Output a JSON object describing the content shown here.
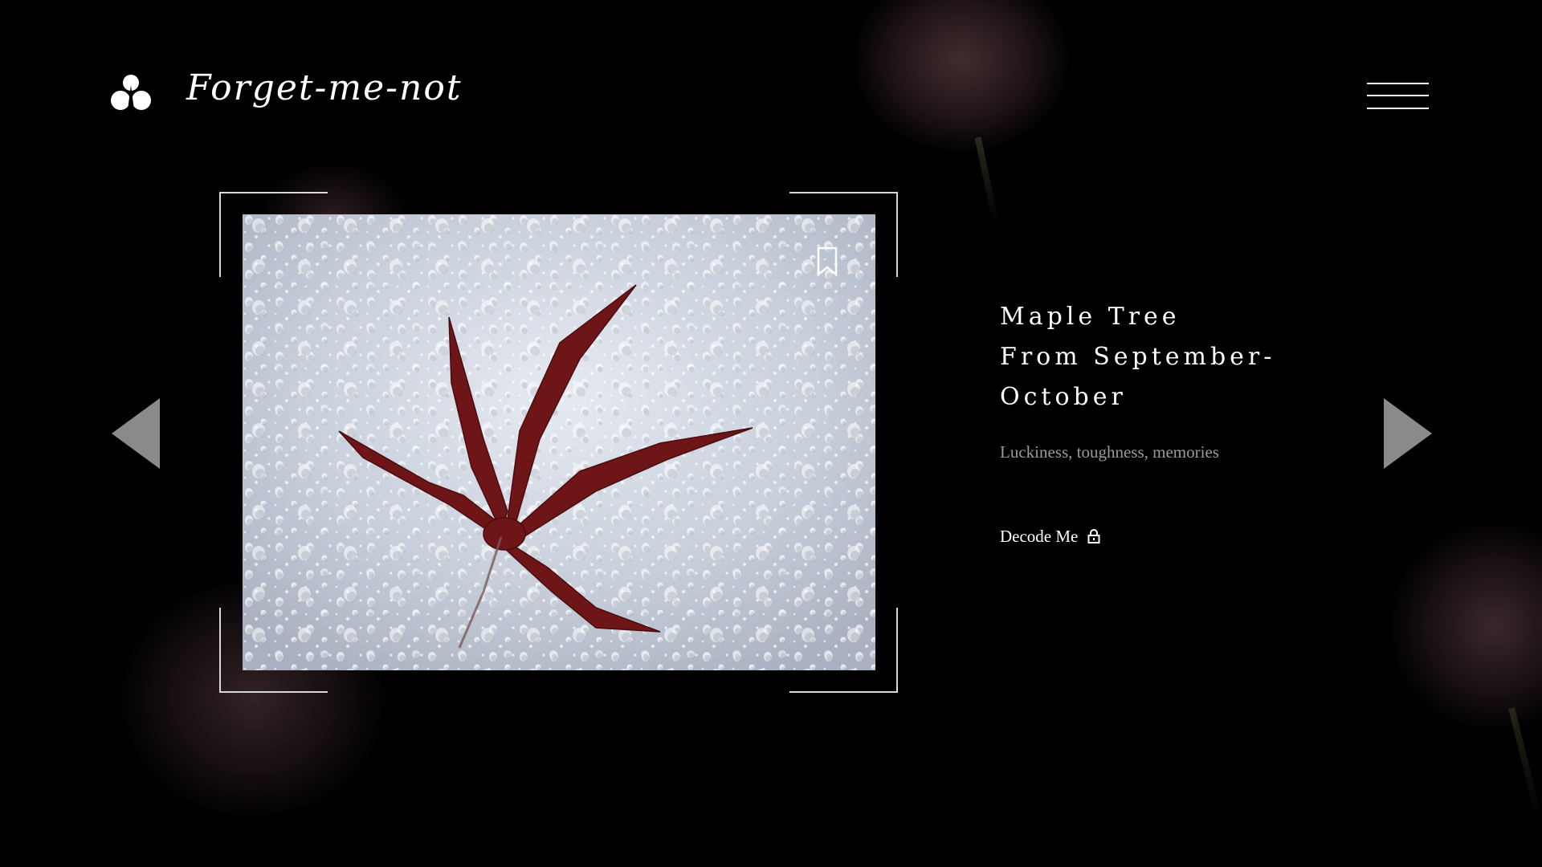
{
  "header": {
    "logo_text": "Forget-me-not",
    "logo_icon": "flower-cluster-icon",
    "menu_icon": "hamburger-menu-icon"
  },
  "carousel": {
    "prev_icon": "triangle-left-icon",
    "next_icon": "triangle-right-icon",
    "arrow_color": "#8a8a8a"
  },
  "card": {
    "image_subject": "red maple leaf under water droplets",
    "bookmark_icon": "bookmark-icon"
  },
  "info": {
    "title_lines": [
      "Maple Tree",
      "From September-",
      "October"
    ],
    "tags": "Luckiness, toughness, memories",
    "decode_label": "Decode Me",
    "decode_icon": "lock-icon"
  },
  "colors": {
    "background": "#000000",
    "text": "#ffffff",
    "muted_text": "#9a9a9a",
    "leaf": "#6e1518"
  }
}
